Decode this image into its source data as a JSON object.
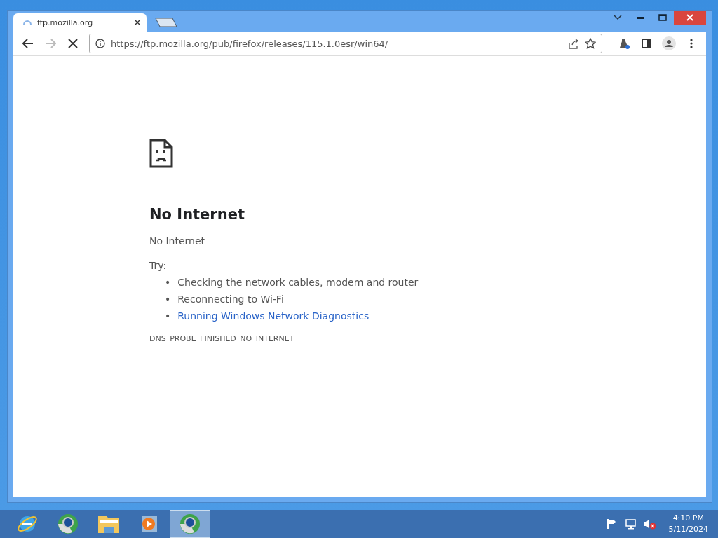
{
  "tabs": [
    {
      "title": "ftp.mozilla.org",
      "selected": true,
      "loading": true
    }
  ],
  "address_bar": {
    "url": "https://ftp.mozilla.org/pub/firefox/releases/115.1.0esr/win64/"
  },
  "error_page": {
    "heading": "No Internet",
    "message": "No Internet",
    "try_label": "Try:",
    "suggestions": [
      {
        "bullet": "•",
        "text": "Checking the network cables, modem and router",
        "kind": "text"
      },
      {
        "bullet": "•",
        "text": "Reconnecting to Wi-Fi",
        "kind": "text"
      },
      {
        "bullet": "•",
        "text": "Running Windows Network Diagnostics",
        "kind": "link"
      }
    ],
    "error_code": "DNS_PROBE_FINISHED_NO_INTERNET"
  },
  "taskbar": {
    "apps": [
      {
        "kind": "ie",
        "selected": false
      },
      {
        "kind": "chrome",
        "selected": false
      },
      {
        "kind": "folder",
        "selected": false
      },
      {
        "kind": "media",
        "selected": false
      },
      {
        "kind": "chrome",
        "selected": true
      }
    ],
    "clock": {
      "time": "4:10 PM",
      "date": "5/11/2024"
    }
  }
}
